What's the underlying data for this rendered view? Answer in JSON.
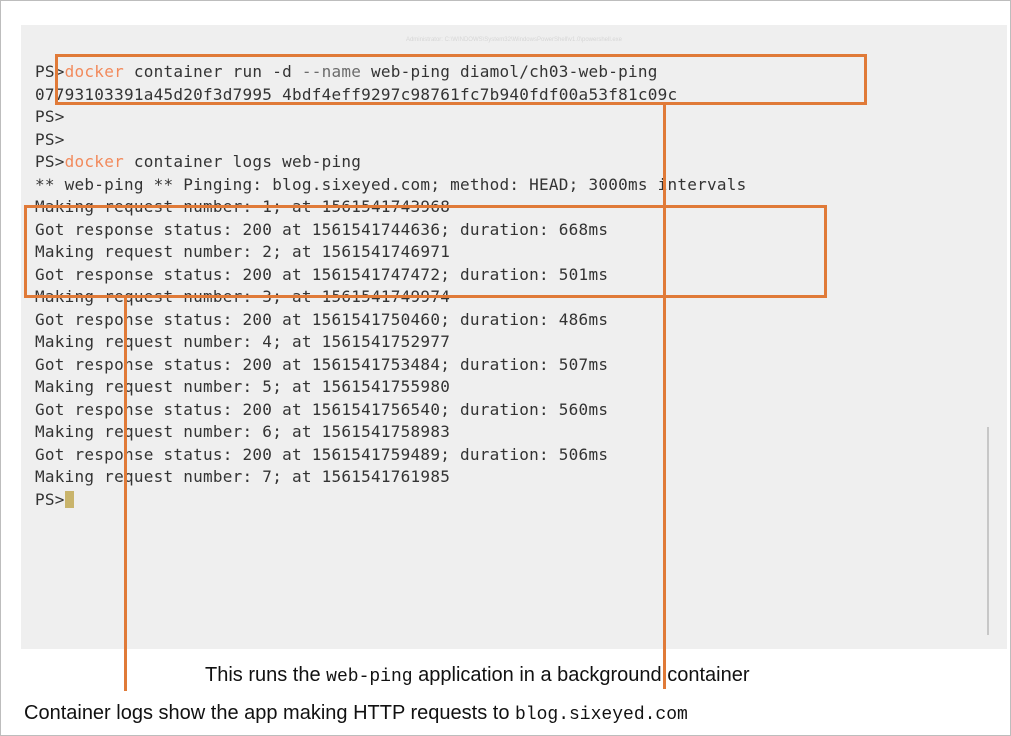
{
  "window": {
    "title": "Administrator: C:\\WINDOWS\\System32\\WindowsPowerShell\\v1.0\\powershell.exe"
  },
  "terminal": {
    "lines": [
      {
        "prompt": "PS>",
        "command": "docker",
        "rest1": " container run -d ",
        "flag": "--name",
        "rest2": " web-ping diamol/ch03-web-ping"
      },
      {
        "text": "07793103391a45d20f3d7995 4bdf4eff9297c98761fc7b940fdf00a53f81c09c"
      },
      {
        "prompt": "PS>"
      },
      {
        "prompt": "PS>"
      },
      {
        "prompt": "PS>",
        "command": "docker",
        "rest1": " container logs web-ping"
      },
      {
        "text": "** web-ping ** Pinging: blog.sixeyed.com; method: HEAD; 3000ms intervals"
      },
      {
        "text": "Making request number: 1; at 1561541743968"
      },
      {
        "text": "Got response status: 200 at 1561541744636; duration: 668ms"
      },
      {
        "text": "Making request number: 2; at 1561541746971"
      },
      {
        "text": "Got response status: 200 at 1561541747472; duration: 501ms"
      },
      {
        "text": "Making request number: 3; at 1561541749974"
      },
      {
        "text": "Got response status: 200 at 1561541750460; duration: 486ms"
      },
      {
        "text": "Making request number: 4; at 1561541752977"
      },
      {
        "text": "Got response status: 200 at 1561541753484; duration: 507ms"
      },
      {
        "text": "Making request number: 5; at 1561541755980"
      },
      {
        "text": "Got response status: 200 at 1561541756540; duration: 560ms"
      },
      {
        "text": "Making request number: 6; at 1561541758983"
      },
      {
        "text": "Got response status: 200 at 1561541759489; duration: 506ms"
      },
      {
        "text": "Making request number: 7; at 1561541761985"
      },
      {
        "prompt": "PS>",
        "cursor": true
      }
    ]
  },
  "annotations": {
    "run_note": {
      "before": "This runs the ",
      "code": "web-ping",
      "after": " application in a background container"
    },
    "logs_note": {
      "before": "Container logs show the app making HTTP requests to ",
      "code": "blog.sixeyed.com"
    }
  },
  "colors": {
    "accent": "#e07a38",
    "command": "#f28a5c",
    "terminal_bg": "#efefef",
    "text": "#333333",
    "cursor": "#c9b46b"
  }
}
